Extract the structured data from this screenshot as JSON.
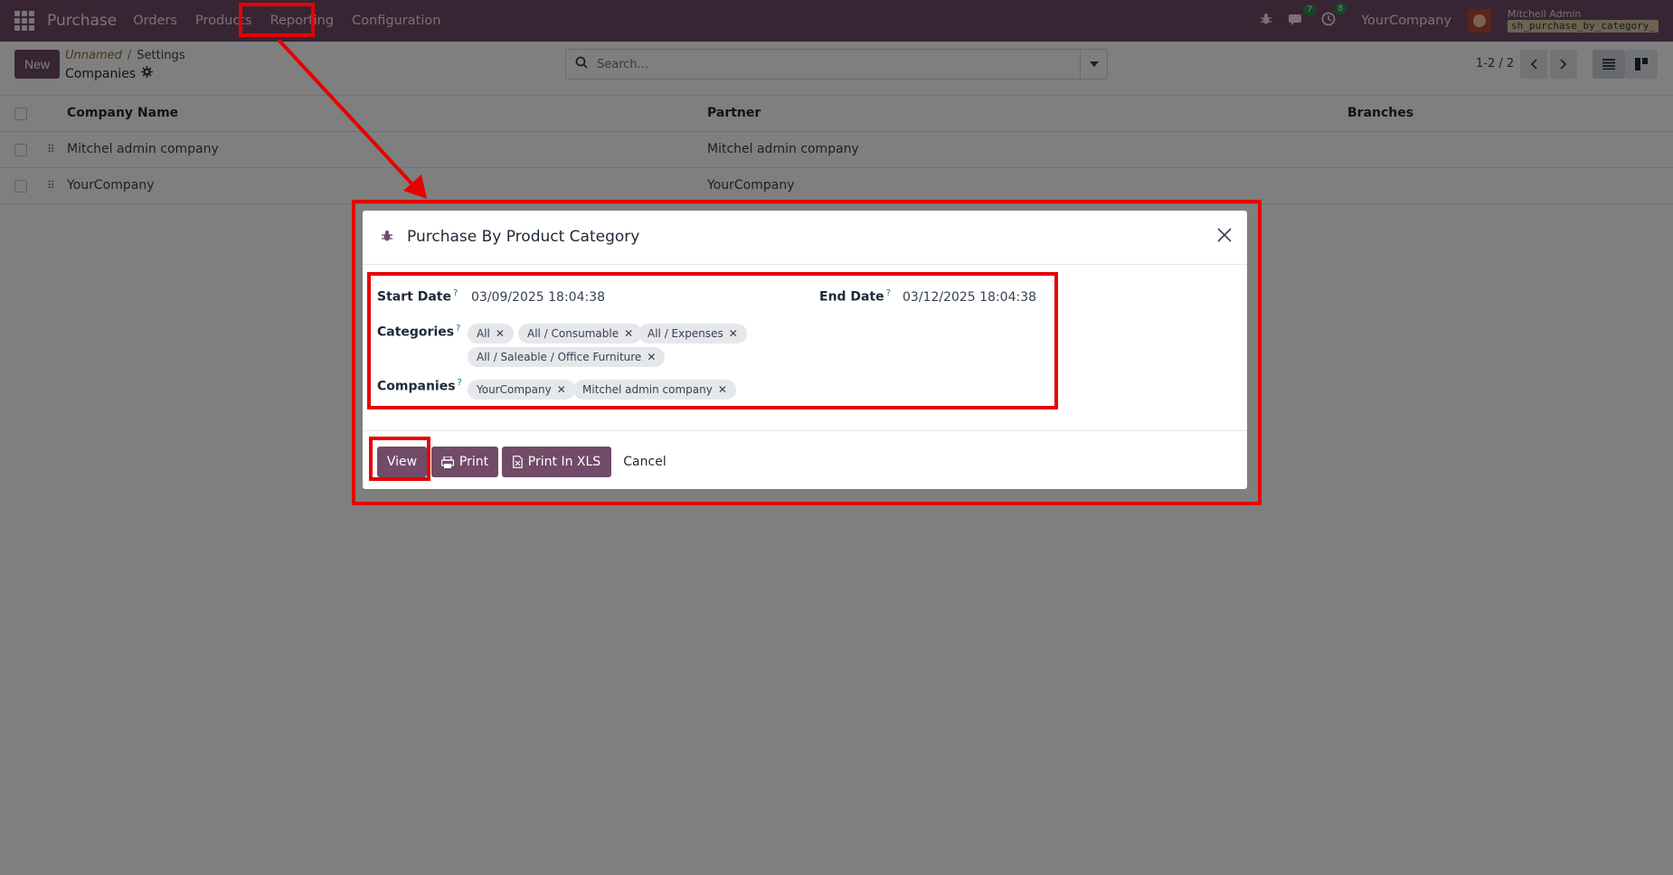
{
  "navbar": {
    "app_name": "Purchase",
    "menu": [
      "Orders",
      "Products",
      "Reporting",
      "Configuration"
    ],
    "chat_count": "7",
    "activity_count": "8",
    "company": "YourCompany",
    "user_name": "Mitchell Admin",
    "user_db": "sh_purchase_by_category_"
  },
  "control": {
    "new_label": "New",
    "breadcrumb_parent": "Unnamed",
    "breadcrumb_sep": "/",
    "breadcrumb_current": "Settings",
    "subtitle": "Companies",
    "search_placeholder": "Search...",
    "pager": "1-2 / 2"
  },
  "list": {
    "headers": [
      "Company Name",
      "Partner",
      "Branches"
    ],
    "rows": [
      {
        "company": "Mitchel admin company",
        "partner": "Mitchel admin company"
      },
      {
        "company": "YourCompany",
        "partner": "YourCompany"
      }
    ]
  },
  "dialog": {
    "title": "Purchase By Product Category",
    "start_label": "Start Date",
    "start_value": "03/09/2025 18:04:38",
    "end_label": "End Date",
    "end_value": "03/12/2025 18:04:38",
    "categories_label": "Categories",
    "categories": [
      "All",
      "All / Consumable",
      "All / Expenses",
      "All / Saleable / Office Furniture"
    ],
    "companies_label": "Companies",
    "companies": [
      "YourCompany",
      "Mitchel admin company"
    ],
    "help_mark": "?",
    "buttons": {
      "view": "View",
      "print": "Print",
      "print_xls": "Print In XLS",
      "cancel": "Cancel"
    }
  },
  "colors": {
    "brand": "#714b67",
    "annotation": "#e60000"
  }
}
